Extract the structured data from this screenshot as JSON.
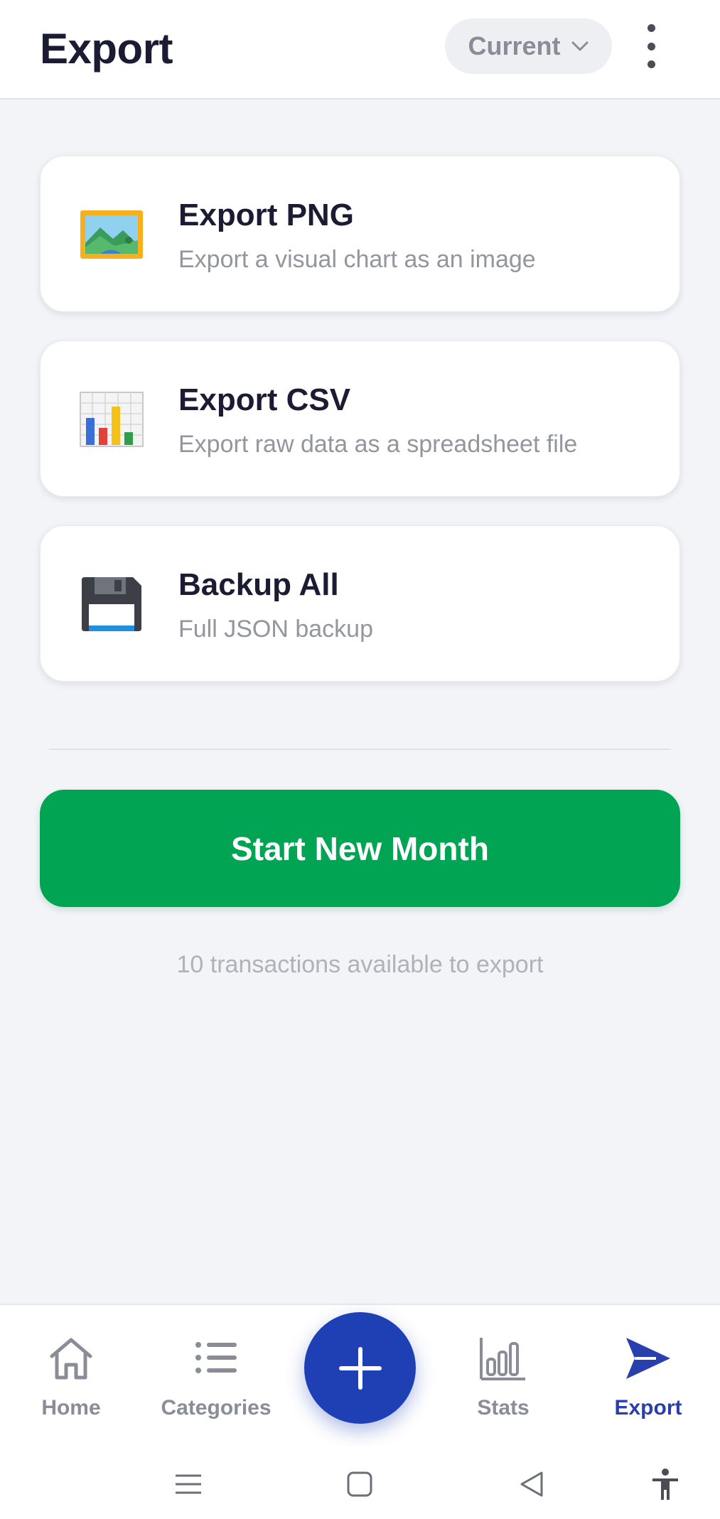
{
  "header": {
    "title": "Export",
    "period_label": "Current",
    "icons": {
      "period": "chevron-down-icon",
      "menu": "more-vertical-icon"
    }
  },
  "options": [
    {
      "title": "Export PNG",
      "subtitle": "Export a visual chart as an image",
      "icon": "framed-picture-icon"
    },
    {
      "title": "Export CSV",
      "subtitle": "Export raw data as a spreadsheet file",
      "icon": "bar-chart-icon"
    },
    {
      "title": "Backup All",
      "subtitle": "Full JSON backup",
      "icon": "floppy-disk-icon"
    }
  ],
  "actions": {
    "start_new_month": "Start New Month"
  },
  "footnote": "10 transactions available to export",
  "bottom_nav": {
    "items": [
      {
        "label": "Home",
        "icon": "home-icon",
        "active": false
      },
      {
        "label": "Categories",
        "icon": "list-icon",
        "active": false
      },
      {
        "label": "Stats",
        "icon": "stats-icon",
        "active": false
      },
      {
        "label": "Export",
        "icon": "send-icon",
        "active": true
      }
    ],
    "fab_icon": "plus-icon"
  },
  "system_nav": {
    "icons": [
      "recent-apps-icon",
      "home-square-icon",
      "back-icon",
      "accessibility-icon"
    ]
  },
  "colors": {
    "accent": "#1f40b5",
    "active_nav": "#2a3fae",
    "primary_button": "#01a453",
    "title_text": "#1b1c33",
    "muted_text": "#93959f",
    "background": "#f3f4f8"
  }
}
